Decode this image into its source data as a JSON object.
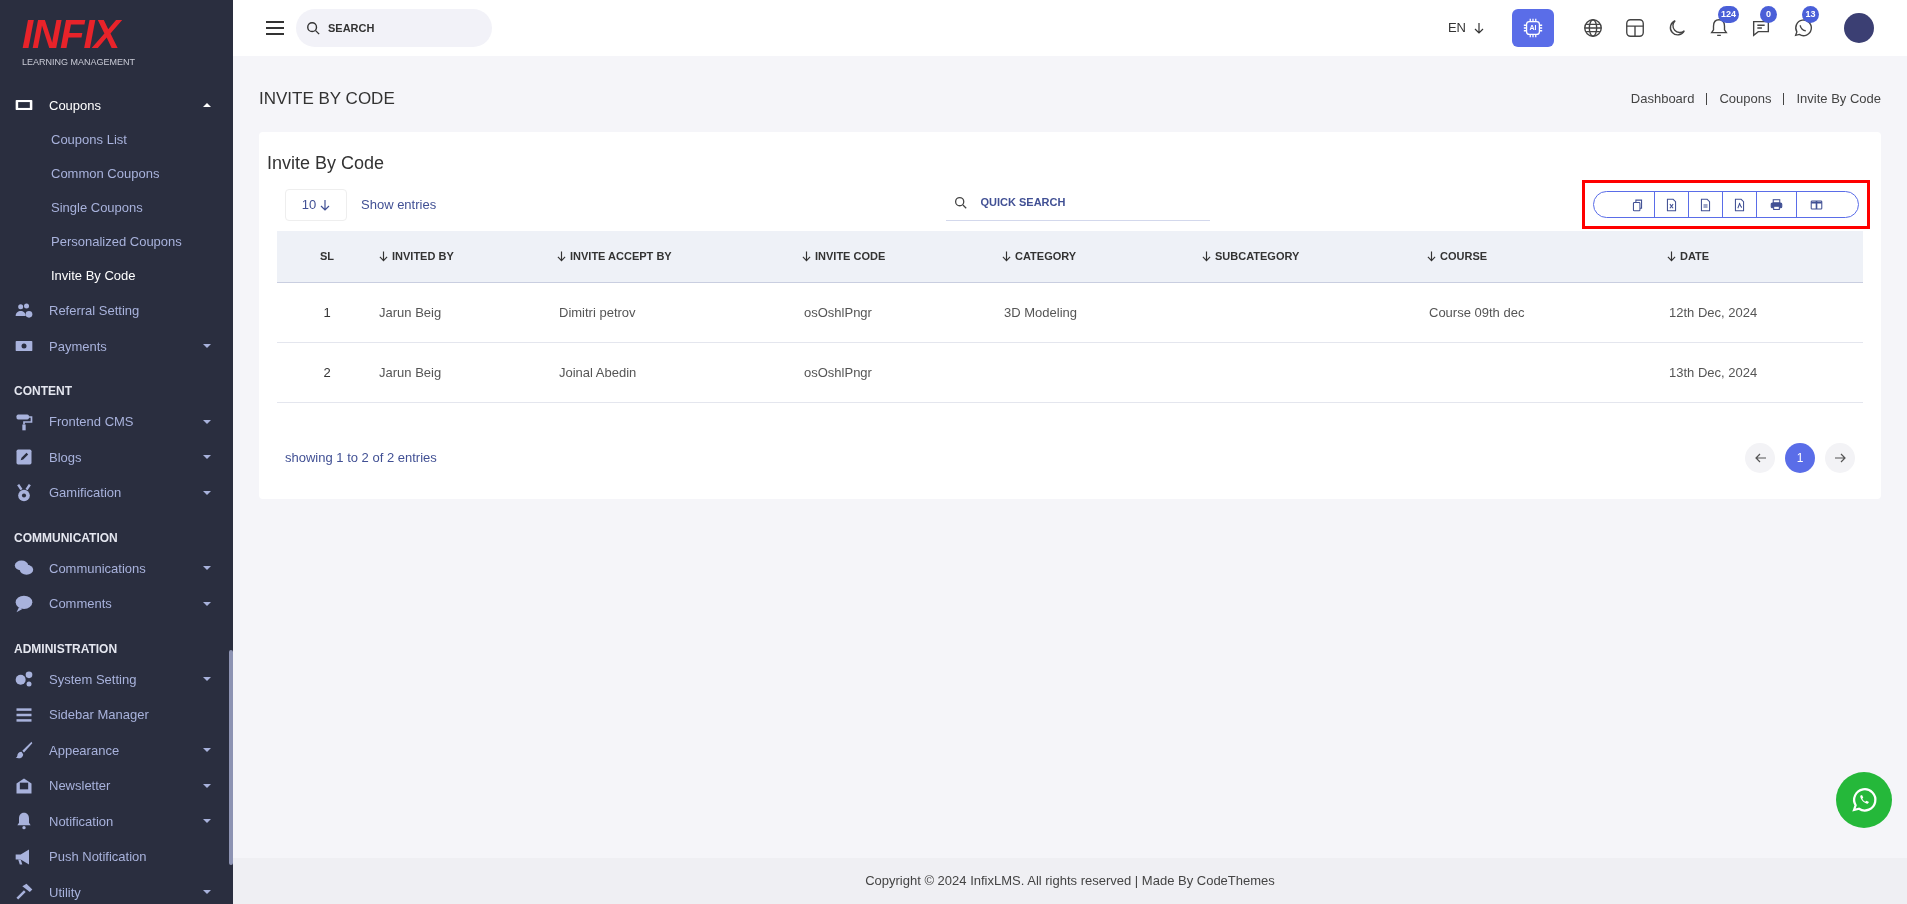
{
  "sidebar": {
    "logo": {
      "text": "INFIX",
      "subtitle": "LEARNING MANAGEMENT"
    },
    "sections": [
      {
        "items": [
          {
            "label": "Coupons",
            "expanded": true,
            "children": [
              {
                "label": "Coupons List",
                "selected": false
              },
              {
                "label": "Common Coupons",
                "selected": false
              },
              {
                "label": "Single Coupons",
                "selected": false
              },
              {
                "label": "Personalized Coupons",
                "selected": false
              },
              {
                "label": "Invite By Code",
                "selected": true
              }
            ]
          },
          {
            "label": "Referral Setting"
          },
          {
            "label": "Payments",
            "expanded": false
          }
        ]
      },
      {
        "heading": "CONTENT",
        "items": [
          {
            "label": "Frontend CMS",
            "expanded": false
          },
          {
            "label": "Blogs",
            "expanded": false
          },
          {
            "label": "Gamification",
            "expanded": false
          }
        ]
      },
      {
        "heading": "COMMUNICATION",
        "items": [
          {
            "label": "Communications",
            "expanded": false
          },
          {
            "label": "Comments",
            "expanded": false
          }
        ]
      },
      {
        "heading": "ADMINISTRATION",
        "items": [
          {
            "label": "System Setting",
            "expanded": false
          },
          {
            "label": "Sidebar Manager"
          },
          {
            "label": "Appearance",
            "expanded": false
          },
          {
            "label": "Newsletter",
            "expanded": false
          },
          {
            "label": "Notification",
            "expanded": false
          },
          {
            "label": "Push Notification"
          },
          {
            "label": "Utility",
            "expanded": false
          }
        ]
      }
    ]
  },
  "header": {
    "search": {
      "placeholder": "SEARCH"
    },
    "language": "EN",
    "ai_button": "AI",
    "badges": [
      "124",
      "0",
      "13"
    ]
  },
  "page": {
    "title": "INVITE BY CODE",
    "breadcrumb": [
      "Dashboard",
      "Coupons",
      "Invite By Code"
    ]
  },
  "card": {
    "title": "Invite By Code",
    "page_size": "10",
    "show_entries": "Show entries",
    "quick_search": {
      "placeholder": "QUICK SEARCH"
    },
    "export_toolbar": {
      "highlighted": true
    },
    "table": {
      "columns": [
        {
          "label": "SL",
          "sortable": false
        },
        {
          "label": "INVITED BY",
          "sortable": true
        },
        {
          "label": "INVITE ACCEPT BY",
          "sortable": true
        },
        {
          "label": "INVITE CODE",
          "sortable": true
        },
        {
          "label": "CATEGORY",
          "sortable": true
        },
        {
          "label": "SUBCATEGORY",
          "sortable": true
        },
        {
          "label": "COURSE",
          "sortable": true
        },
        {
          "label": "DATE",
          "sortable": true
        }
      ],
      "rows": [
        {
          "sl": "1",
          "invited_by": "Jarun Beig",
          "invite_accept_by": "Dimitri petrov",
          "invite_code": "osOshlPngr",
          "category": "3D Modeling",
          "course": "Course 09th dec",
          "date": "12th Dec, 2024"
        },
        {
          "sl": "2",
          "invited_by": "Jarun Beig",
          "invite_accept_by": "Joinal Abedin",
          "invite_code": "osOshlPngr",
          "date": "13th Dec, 2024"
        }
      ]
    },
    "summary": "showing 1 to 2 of 2 entries",
    "pagination": [
      {
        "label": "1",
        "selected": true
      }
    ]
  },
  "footer": "Copyright © 2024 InfixLMS. All rights reserved | Made By CodeThemes"
}
